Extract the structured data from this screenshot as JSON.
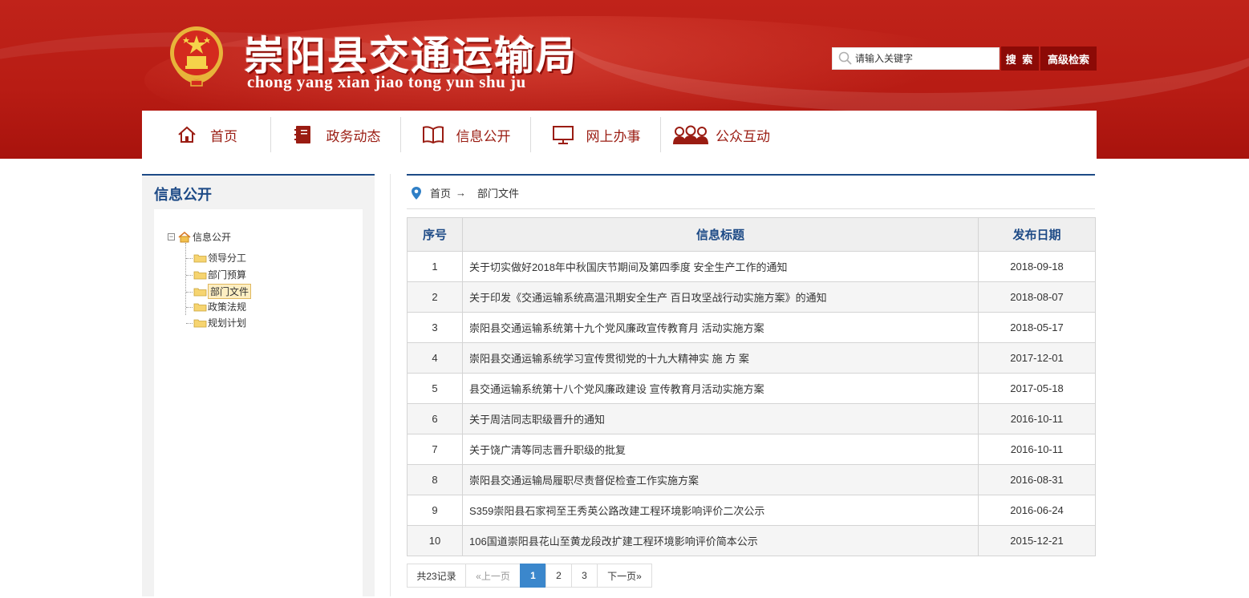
{
  "header": {
    "title": "崇阳县交通运输局",
    "pinyin": "chong yang xian jiao tong yun shu ju",
    "search_placeholder": "请输入关键字",
    "search_label": "搜 索",
    "advanced_label": "高级检索"
  },
  "nav": {
    "items": [
      {
        "label": "首页",
        "icon": "home-icon"
      },
      {
        "label": "政务动态",
        "icon": "notebook-icon"
      },
      {
        "label": "信息公开",
        "icon": "open-book-icon"
      },
      {
        "label": "网上办事",
        "icon": "monitor-icon"
      },
      {
        "label": "公众互动",
        "icon": "people-icon"
      }
    ]
  },
  "sidebar": {
    "title": "信息公开",
    "tree_root": "信息公开",
    "items": [
      {
        "label": "领导分工",
        "active": false
      },
      {
        "label": "部门预算",
        "active": false
      },
      {
        "label": "部门文件",
        "active": true
      },
      {
        "label": "政策法规",
        "active": false
      },
      {
        "label": "规划计划",
        "active": false
      }
    ]
  },
  "breadcrumb": {
    "home": "首页",
    "arrow": "→",
    "current": "部门文件"
  },
  "table": {
    "headers": [
      "序号",
      "信息标题",
      "发布日期"
    ],
    "rows": [
      {
        "no": "1",
        "title": "关于切实做好2018年中秋国庆节期间及第四季度 安全生产工作的通知",
        "date": "2018-09-18"
      },
      {
        "no": "2",
        "title": "关于印发《交通运输系统高温汛期安全生产 百日攻坚战行动实施方案》的通知",
        "date": "2018-08-07"
      },
      {
        "no": "3",
        "title": "崇阳县交通运输系统第十九个党风廉政宣传教育月 活动实施方案",
        "date": "2018-05-17"
      },
      {
        "no": "4",
        "title": "崇阳县交通运输系统学习宣传贯彻党的十九大精神实 施 方 案",
        "date": "2017-12-01"
      },
      {
        "no": "5",
        "title": "县交通运输系统第十八个党风廉政建设 宣传教育月活动实施方案",
        "date": "2017-05-18"
      },
      {
        "no": "6",
        "title": "关于周洁同志职级晋升的通知",
        "date": "2016-10-11"
      },
      {
        "no": "7",
        "title": "关于饶广清等同志晋升职级的批复",
        "date": "2016-10-11"
      },
      {
        "no": "8",
        "title": "崇阳县交通运输局履职尽责督促检查工作实施方案",
        "date": "2016-08-31"
      },
      {
        "no": "9",
        "title": "S359崇阳县石家祠至王秀英公路改建工程环境影响评价二次公示",
        "date": "2016-06-24"
      },
      {
        "no": "10",
        "title": "106国道崇阳县花山至黄龙段改扩建工程环境影响评价简本公示",
        "date": "2015-12-21"
      }
    ]
  },
  "pager": {
    "total": "共23记录",
    "prev": "«上一页",
    "pages": [
      "1",
      "2",
      "3"
    ],
    "current": "1",
    "next": "下一页»"
  },
  "colors": {
    "header_red": "#b81c14",
    "nav_text": "#9a1c12",
    "blue_accent": "#1d4a86",
    "pager_active": "#3b87cc",
    "button_dark_red": "#8c0a06"
  }
}
